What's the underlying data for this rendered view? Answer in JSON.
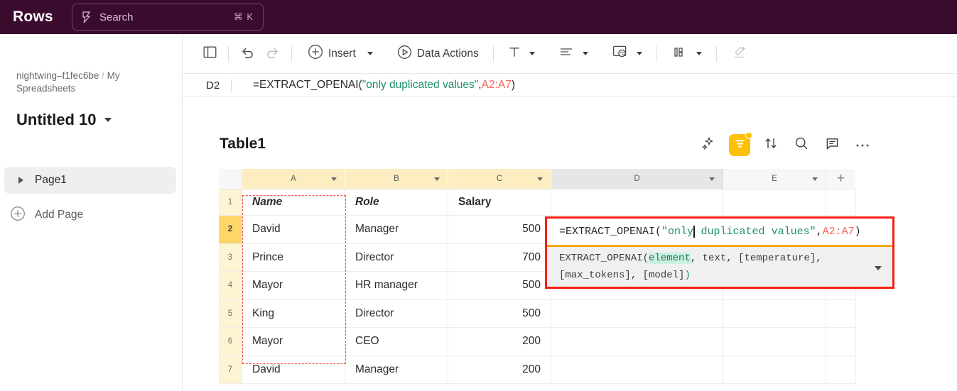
{
  "topbar": {
    "brand": "Rows",
    "search": {
      "placeholder": "Search",
      "shortcut": "⌘ K",
      "icon": "lightning-search-icon"
    }
  },
  "sidebar": {
    "breadcrumb_workspace": "nightwing–f1fec6be",
    "breadcrumb_sep": "/",
    "breadcrumb_folder": "My Spreadsheets",
    "doc_title": "Untitled 10",
    "pages": [
      {
        "label": "Page1",
        "expanded": false
      }
    ],
    "add_page_label": "Add Page"
  },
  "toolbar": {
    "panel_toggle_icon": "sidebar-panel-icon",
    "undo_label": "undo-icon",
    "redo_label": "redo-icon",
    "insert_label": "Insert",
    "data_actions_label": "Data Actions",
    "text_icon": "text-format-icon",
    "align_icon": "align-icon",
    "fill_icon": "fill-color-icon",
    "number_icon": "number-format-icon",
    "clear_icon": "clear-format-icon"
  },
  "formula_bar": {
    "cell_ref": "D2",
    "prefix": "=EXTRACT_OPENAI(",
    "string_arg": "\"only duplicated values\"",
    "comma": ",",
    "range_arg": "A2:A7",
    "suffix": ")"
  },
  "table": {
    "title": "Table1",
    "tools": [
      {
        "name": "ai-magic-icon",
        "label": "AI"
      },
      {
        "name": "filter-icon",
        "label": "Filter",
        "active": true,
        "badge": true
      },
      {
        "name": "sort-icon",
        "label": "Sort"
      },
      {
        "name": "search-icon",
        "label": "Search"
      },
      {
        "name": "comment-icon",
        "label": "Comment"
      },
      {
        "name": "more-icon",
        "label": "More"
      }
    ],
    "columns": [
      {
        "letter": "A",
        "state": "selected"
      },
      {
        "letter": "B",
        "state": "selected"
      },
      {
        "letter": "C",
        "state": "selected"
      },
      {
        "letter": "D",
        "state": "active"
      },
      {
        "letter": "E",
        "state": "plain"
      }
    ],
    "add_column_label": "+",
    "header_row": {
      "number": "1",
      "cells": [
        "Name",
        "Role",
        "Salary",
        "",
        ""
      ]
    },
    "rows": [
      {
        "number": "2",
        "active": true,
        "cells": [
          "David",
          "Manager",
          "500",
          "",
          ""
        ]
      },
      {
        "number": "3",
        "active": false,
        "cells": [
          "Prince",
          "Director",
          "700",
          "",
          ""
        ]
      },
      {
        "number": "4",
        "active": false,
        "cells": [
          "Mayor",
          "HR manager",
          "500",
          "",
          ""
        ]
      },
      {
        "number": "5",
        "active": false,
        "cells": [
          "King",
          "Director",
          "500",
          "",
          ""
        ]
      },
      {
        "number": "6",
        "active": false,
        "cells": [
          "Mayor",
          "CEO",
          "200",
          "",
          ""
        ]
      },
      {
        "number": "7",
        "active": false,
        "cells": [
          "David",
          "Manager",
          "200",
          "",
          ""
        ]
      }
    ]
  },
  "cell_editor": {
    "prefix": "=EXTRACT_OPENAI(",
    "string_before_caret": "\"only",
    "string_after_caret": " duplicated values\"",
    "comma": ",",
    "range_arg": "A2:A7",
    "suffix": ")",
    "hint_fn": "EXTRACT_OPENAI(",
    "hint_active_param": "element",
    "hint_rest": ", text, [temperature], [max_tokens], [model]",
    "hint_close": ")"
  },
  "colors": {
    "brand_bg": "#3b0b2e",
    "accent_yellow": "#ffc107",
    "selected_col_header": "#fceec0",
    "active_row_header": "#fcd667",
    "range_outline": "#f4544a",
    "annotation_red": "#f71f13",
    "editor_border": "#f5a800",
    "string_green": "#1a8f6a",
    "ref_red": "#f2685c"
  }
}
